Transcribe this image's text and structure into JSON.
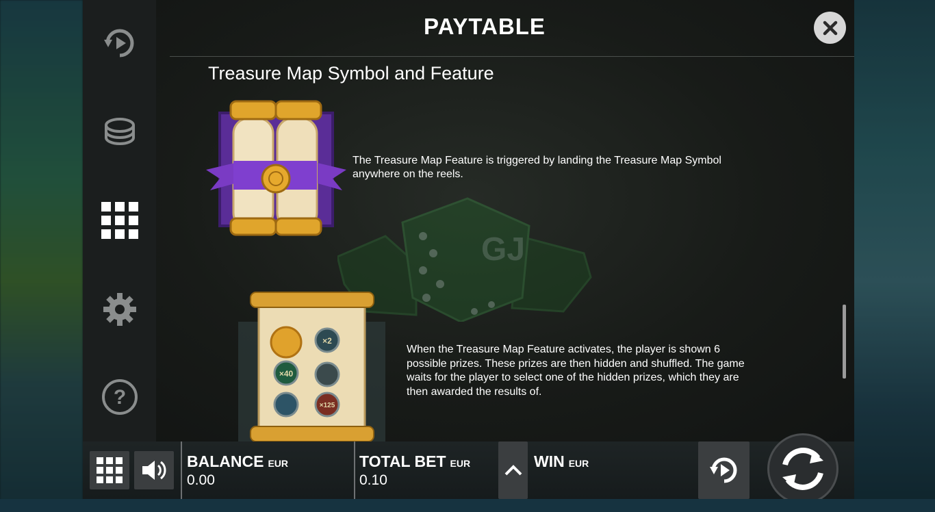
{
  "header": {
    "title": "PAYTABLE",
    "close_icon": "close-icon"
  },
  "sidebar": {
    "items": [
      {
        "name": "autoplay-icon",
        "label": ""
      },
      {
        "name": "coins-icon",
        "label": ""
      },
      {
        "name": "paytable-grid-icon",
        "label": ""
      },
      {
        "name": "settings-gear-icon",
        "label": ""
      },
      {
        "name": "help-icon",
        "label": ""
      }
    ]
  },
  "paytable": {
    "section_title": "Treasure Map Symbol and Feature",
    "paragraph1": "The Treasure Map Feature is triggered by landing the Treasure Map Symbol anywhere on the reels.",
    "paragraph2": "When the Treasure Map Feature activates, the player is shown 6 possible prizes. These prizes are then hidden and shuffled. The game waits for the player to select one of the hidden prizes, which they are then awarded the results of.",
    "prize_labels": [
      "×2",
      "×40",
      "×125"
    ]
  },
  "bottom_bar": {
    "balance_label": "BALANCE",
    "balance_currency": "EUR",
    "balance_value": "0.00",
    "total_bet_label": "TOTAL BET",
    "total_bet_currency": "EUR",
    "total_bet_value": "0.10",
    "win_label": "WIN",
    "win_currency": "EUR",
    "win_value": ""
  },
  "colors": {
    "accent": "#ffffff",
    "panel": "#151817",
    "ribbon": "#6a2ba8",
    "gold": "#e2a72e"
  }
}
